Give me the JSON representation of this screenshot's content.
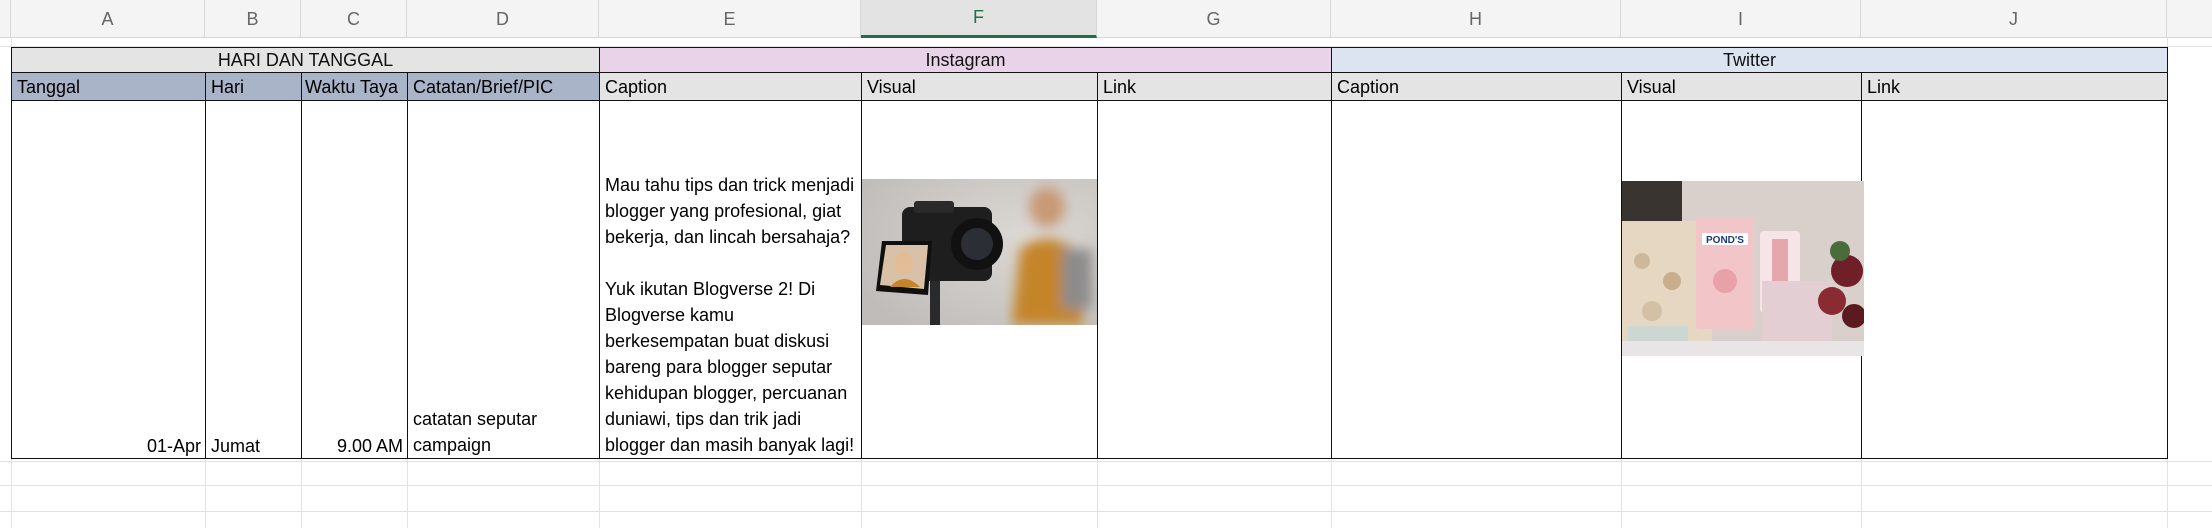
{
  "columns": [
    "A",
    "B",
    "C",
    "D",
    "E",
    "F",
    "G",
    "H",
    "I",
    "J"
  ],
  "selected_column": "F",
  "groups": {
    "hari_tanggal": "HARI DAN TANGGAL",
    "instagram": "Instagram",
    "twitter": "Twitter"
  },
  "subheaders": {
    "tanggal": "Tanggal",
    "hari": "Hari",
    "waktu": "Waktu Taya",
    "catatan": "Catatan/Brief/PIC",
    "ig_caption": "Caption",
    "ig_visual": "Visual",
    "ig_link": "Link",
    "tw_caption": "Caption",
    "tw_visual": "Visual",
    "tw_link": "Link"
  },
  "row": {
    "tanggal": "01-Apr",
    "hari": "Jumat",
    "waktu": "9.00 AM",
    "catatan_line1": "catatan seputar",
    "catatan_line2": "campaign",
    "caption_lines": [
      "Mau tahu tips dan trick menjadi",
      "blogger yang profesional, giat",
      "bekerja, dan lincah bersahaja?",
      "",
      "Yuk ikutan Blogverse 2! Di",
      "Blogverse kamu",
      "berkesempatan buat diskusi",
      "bareng para blogger seputar",
      "kehidupan blogger, percuanan",
      "duniawi, tips dan trik jadi",
      "blogger dan masih banyak lagi!"
    ],
    "ig_image_icon": "camera-photo-image",
    "tw_image_icon": "ponds-products-image",
    "tw_image_brand": "POND'S"
  },
  "colors": {
    "header_bg": "#f4f4f4",
    "selected_col": "#1e7145",
    "hari_tanggal_bg": "#e4e4e4",
    "subheader_bluegray": "#aab4c8",
    "instagram_bg": "#e9d3e9",
    "twitter_bg": "#dce3f1"
  }
}
